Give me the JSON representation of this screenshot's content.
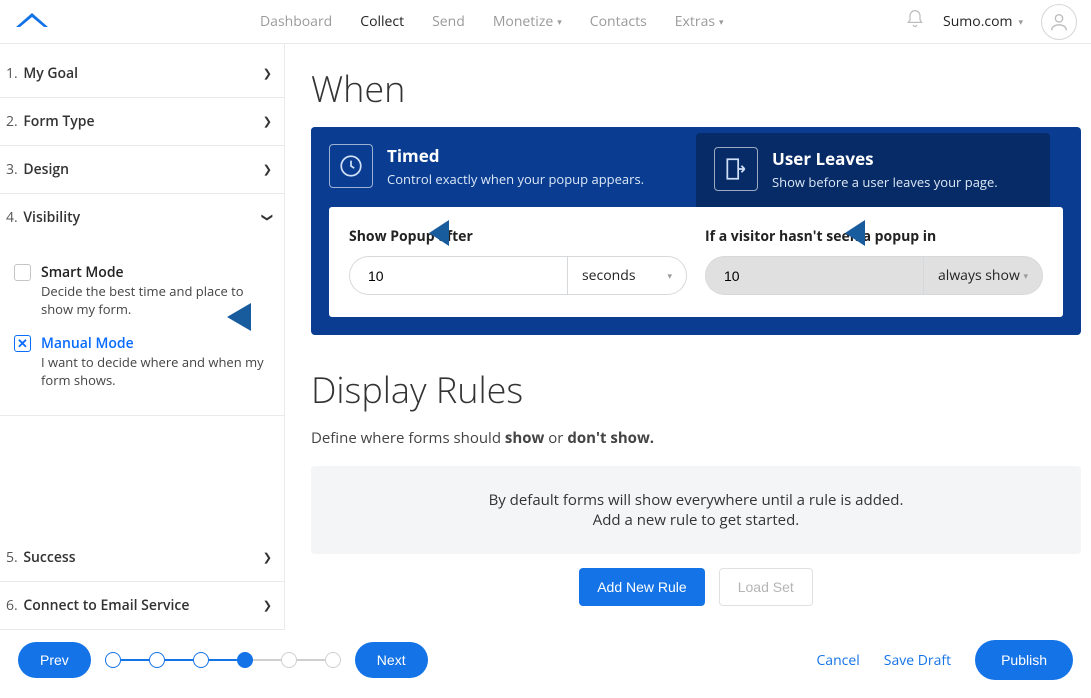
{
  "nav": {
    "items": [
      "Dashboard",
      "Collect",
      "Send",
      "Monetize",
      "Contacts",
      "Extras"
    ],
    "active": "Collect",
    "account_label": "Sumo.com"
  },
  "sidebar": {
    "steps": [
      {
        "num": "1.",
        "label": "My Goal"
      },
      {
        "num": "2.",
        "label": "Form Type"
      },
      {
        "num": "3.",
        "label": "Design"
      },
      {
        "num": "4.",
        "label": "Visibility"
      },
      {
        "num": "5.",
        "label": "Success"
      },
      {
        "num": "6.",
        "label": "Connect to Email Service"
      }
    ],
    "smart": {
      "title": "Smart Mode",
      "desc": "Decide the best time and place to show my form."
    },
    "manual": {
      "title": "Manual Mode",
      "desc": "I want to decide where and when my form shows."
    }
  },
  "when": {
    "title": "When",
    "tabs": {
      "timed": {
        "title": "Timed",
        "sub": "Control exactly when your popup appears."
      },
      "leaves": {
        "title": "User Leaves",
        "sub": "Show before a user leaves your page."
      }
    },
    "fields": {
      "after": {
        "label": "Show Popup after",
        "value": "10",
        "unit": "seconds"
      },
      "notseen": {
        "label": "If a visitor hasn't seen a popup in",
        "value": "10",
        "unit": "always show"
      }
    }
  },
  "rules": {
    "title": "Display Rules",
    "desc_pre": "Define where forms should ",
    "desc_show": "show",
    "desc_or": " or ",
    "desc_dont": "don't show.",
    "box_l1": "By default forms will show everywhere until a rule is added.",
    "box_l2": "Add a new rule to get started.",
    "add": "Add New Rule",
    "load": "Load Set"
  },
  "bottom": {
    "prev": "Prev",
    "next": "Next",
    "cancel": "Cancel",
    "save": "Save Draft",
    "publish": "Publish"
  }
}
